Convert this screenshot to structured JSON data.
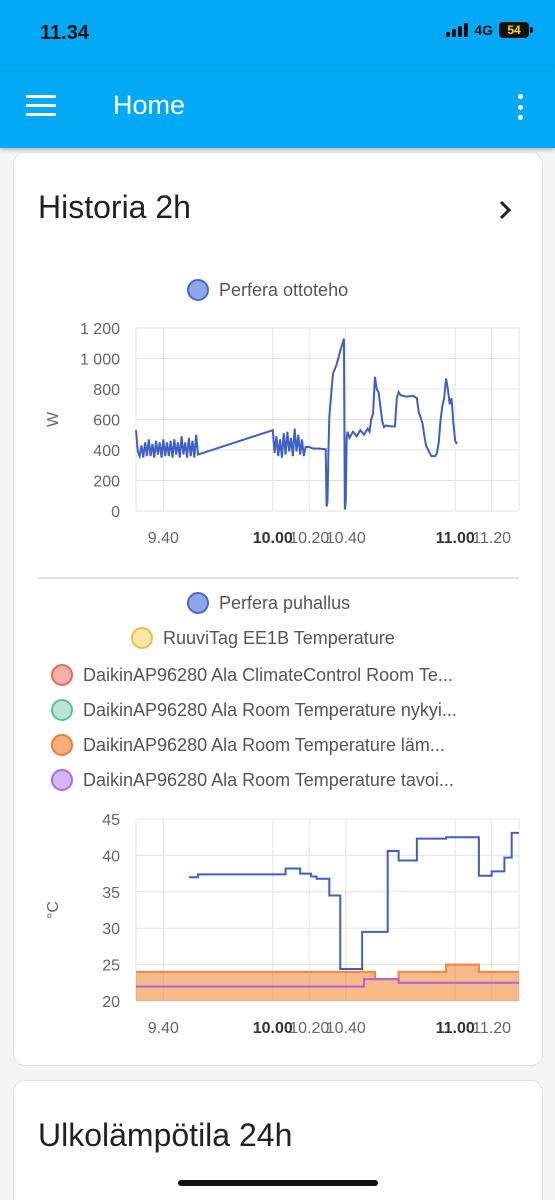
{
  "status": {
    "time": "11.34",
    "network": "4G",
    "battery": "54"
  },
  "appbar": {
    "title": "Home",
    "menu_icon": "hamburger-menu-icon",
    "more_icon": "more-vert-icon"
  },
  "card1": {
    "title": "Historia 2h",
    "chevron_icon": "chevron-right-icon",
    "chart1_legend": [
      {
        "label": "Perfera ottoteho",
        "color": "#8fa6e8",
        "border": "#4a67c9"
      }
    ],
    "chart2_legend": [
      {
        "label": "Perfera puhallus",
        "color": "#8fa6e8",
        "border": "#4a67c9"
      },
      {
        "label": "RuuviTag EE1B Temperature",
        "color": "#fde6a6",
        "border": "#e9bf4a"
      },
      {
        "label": "DaikinAP96280 Ala ClimateControl Room Te...",
        "color": "#f9b0a8",
        "border": "#e06c60"
      },
      {
        "label": "DaikinAP96280 Ala Room Temperature nykyi...",
        "color": "#b8e6d4",
        "border": "#5fbf9b"
      },
      {
        "label": "DaikinAP96280 Ala Room Temperature läm...",
        "color": "#fbb07a",
        "border": "#ee7a33"
      },
      {
        "label": "DaikinAP96280 Ala Room Temperature tavoi...",
        "color": "#d5b6f4",
        "border": "#a26fe0"
      }
    ]
  },
  "card2": {
    "title": "Ulkolämpötila 24h"
  },
  "chart_data": [
    {
      "type": "line",
      "title": "",
      "ylabel": "W",
      "xlim": [
        9.25,
        11.35
      ],
      "ylim": [
        0,
        1200
      ],
      "yticks": [
        0,
        200,
        400,
        600,
        800,
        1000,
        1200
      ],
      "ytick_labels": [
        "0",
        "200",
        "400",
        "600",
        "800",
        "1 000",
        "1 200"
      ],
      "xticks": [
        9.4,
        10.0,
        10.2,
        10.4,
        11.0,
        11.2
      ],
      "xtick_labels": [
        "9.40",
        "10.00",
        "10.20",
        "10.40",
        "11.00",
        "11.20"
      ],
      "bold_xticks": [
        "10.00",
        "11.00"
      ],
      "grid": true,
      "series": [
        {
          "name": "Perfera ottoteho",
          "color": "#3f5fc4",
          "points": [
            [
              9.25,
              530
            ],
            [
              9.26,
              390
            ],
            [
              9.27,
              360
            ],
            [
              9.28,
              430
            ],
            [
              9.29,
              350
            ],
            [
              9.3,
              450
            ],
            [
              9.31,
              360
            ],
            [
              9.32,
              470
            ],
            [
              9.33,
              360
            ],
            [
              9.34,
              440
            ],
            [
              9.35,
              350
            ],
            [
              9.36,
              460
            ],
            [
              9.37,
              370
            ],
            [
              9.38,
              450
            ],
            [
              9.39,
              350
            ],
            [
              9.4,
              470
            ],
            [
              9.41,
              360
            ],
            [
              9.42,
              450
            ],
            [
              9.43,
              360
            ],
            [
              9.44,
              460
            ],
            [
              9.45,
              350
            ],
            [
              9.46,
              470
            ],
            [
              9.47,
              370
            ],
            [
              9.48,
              450
            ],
            [
              9.49,
              350
            ],
            [
              9.5,
              490
            ],
            [
              9.51,
              370
            ],
            [
              9.52,
              450
            ],
            [
              9.53,
              350
            ],
            [
              9.54,
              480
            ],
            [
              9.55,
              360
            ],
            [
              9.56,
              460
            ],
            [
              9.57,
              350
            ],
            [
              9.58,
              500
            ],
            [
              9.59,
              370
            ],
            [
              10.0,
              530
            ],
            [
              10.01,
              380
            ],
            [
              10.02,
              490
            ],
            [
              10.03,
              360
            ],
            [
              10.04,
              470
            ],
            [
              10.05,
              350
            ],
            [
              10.06,
              510
            ],
            [
              10.07,
              370
            ],
            [
              10.08,
              520
            ],
            [
              10.09,
              390
            ],
            [
              10.1,
              480
            ],
            [
              10.11,
              360
            ],
            [
              10.12,
              540
            ],
            [
              10.13,
              390
            ],
            [
              10.14,
              500
            ],
            [
              10.15,
              370
            ],
            [
              10.16,
              470
            ],
            [
              10.17,
              360
            ],
            [
              10.18,
              420
            ],
            [
              10.2,
              420
            ],
            [
              10.22,
              410
            ],
            [
              10.25,
              410
            ],
            [
              10.29,
              405
            ],
            [
              10.295,
              30
            ],
            [
              10.3,
              60
            ],
            [
              10.305,
              390
            ],
            [
              10.31,
              620
            ],
            [
              10.32,
              760
            ],
            [
              10.33,
              900
            ],
            [
              10.35,
              960
            ],
            [
              10.37,
              1050
            ],
            [
              10.385,
              1110
            ],
            [
              10.39,
              1130
            ],
            [
              10.395,
              10
            ],
            [
              10.4,
              60
            ],
            [
              10.405,
              480
            ],
            [
              10.41,
              520
            ],
            [
              10.42,
              480
            ],
            [
              10.44,
              520
            ],
            [
              10.46,
              490
            ],
            [
              10.48,
              530
            ],
            [
              10.5,
              500
            ],
            [
              10.52,
              540
            ],
            [
              10.53,
              520
            ],
            [
              10.54,
              600
            ],
            [
              10.55,
              640
            ],
            [
              10.56,
              880
            ],
            [
              10.57,
              800
            ],
            [
              10.58,
              780
            ],
            [
              10.6,
              590
            ],
            [
              10.61,
              550
            ],
            [
              10.62,
              560
            ],
            [
              10.65,
              555
            ],
            [
              10.67,
              555
            ],
            [
              10.68,
              740
            ],
            [
              10.69,
              780
            ],
            [
              10.7,
              760
            ],
            [
              10.73,
              750
            ],
            [
              10.77,
              755
            ],
            [
              10.79,
              740
            ],
            [
              10.8,
              650
            ],
            [
              10.82,
              580
            ],
            [
              10.83,
              500
            ],
            [
              10.84,
              430
            ],
            [
              10.86,
              380
            ],
            [
              10.87,
              360
            ],
            [
              10.89,
              360
            ],
            [
              10.9,
              380
            ],
            [
              10.91,
              450
            ],
            [
              10.92,
              600
            ],
            [
              10.93,
              690
            ],
            [
              10.94,
              740
            ],
            [
              10.95,
              870
            ],
            [
              10.96,
              800
            ],
            [
              10.97,
              700
            ],
            [
              10.98,
              740
            ],
            [
              10.99,
              580
            ],
            [
              11.0,
              460
            ],
            [
              11.01,
              440
            ]
          ]
        }
      ]
    },
    {
      "type": "line",
      "title": "",
      "ylabel": "°C",
      "xlim": [
        9.25,
        11.35
      ],
      "ylim": [
        20,
        45
      ],
      "yticks": [
        20,
        25,
        30,
        35,
        40,
        45
      ],
      "ytick_labels": [
        "20",
        "25",
        "30",
        "35",
        "40",
        "45"
      ],
      "xticks": [
        9.4,
        10.0,
        10.2,
        10.4,
        11.0,
        11.2
      ],
      "xtick_labels": [
        "9.40",
        "10.00",
        "10.20",
        "10.40",
        "11.00",
        "11.20"
      ],
      "bold_xticks": [
        "10.00",
        "11.00"
      ],
      "grid": true,
      "series": [
        {
          "name": "Perfera puhallus",
          "color": "#3f5fc4",
          "step": true,
          "points": [
            [
              9.54,
              37
            ],
            [
              9.59,
              37.4
            ],
            [
              10.07,
              38.2
            ],
            [
              10.15,
              37.5
            ],
            [
              10.21,
              37.1
            ],
            [
              10.24,
              36.8
            ],
            [
              10.31,
              34.5
            ],
            [
              10.37,
              24.4
            ],
            [
              10.49,
              29.5
            ],
            [
              10.63,
              40.6
            ],
            [
              10.69,
              39.3
            ],
            [
              10.79,
              42.3
            ],
            [
              10.95,
              42.5
            ],
            [
              11.13,
              37.2
            ],
            [
              11.2,
              37.8
            ],
            [
              11.27,
              39.7
            ],
            [
              11.31,
              43.1
            ],
            [
              11.35,
              43.1
            ]
          ]
        },
        {
          "name": "DaikinAP96280 Ala ClimateControl Room Te...",
          "color": "#e8705e",
          "step": true,
          "points": [
            [
              9.25,
              24
            ],
            [
              10.49,
              24
            ],
            [
              10.56,
              23
            ],
            [
              10.69,
              24
            ],
            [
              10.95,
              25
            ],
            [
              11.13,
              24
            ],
            [
              11.35,
              24
            ]
          ]
        },
        {
          "name": "DaikinAP96280 Ala Room Temperature läm...",
          "color": "#f08b3c",
          "step": true,
          "fill": true,
          "points": [
            [
              9.25,
              24
            ],
            [
              10.49,
              24
            ],
            [
              10.56,
              23
            ],
            [
              10.69,
              24
            ],
            [
              10.95,
              25
            ],
            [
              11.13,
              24
            ],
            [
              11.35,
              24
            ]
          ]
        },
        {
          "name": "DaikinAP96280 Ala Room Temperature tavoi...",
          "color": "#b060d8",
          "step": true,
          "points": [
            [
              9.25,
              22
            ],
            [
              10.49,
              22
            ],
            [
              10.5,
              23
            ],
            [
              10.69,
              22.5
            ],
            [
              11.35,
              22.5
            ]
          ]
        }
      ]
    }
  ]
}
